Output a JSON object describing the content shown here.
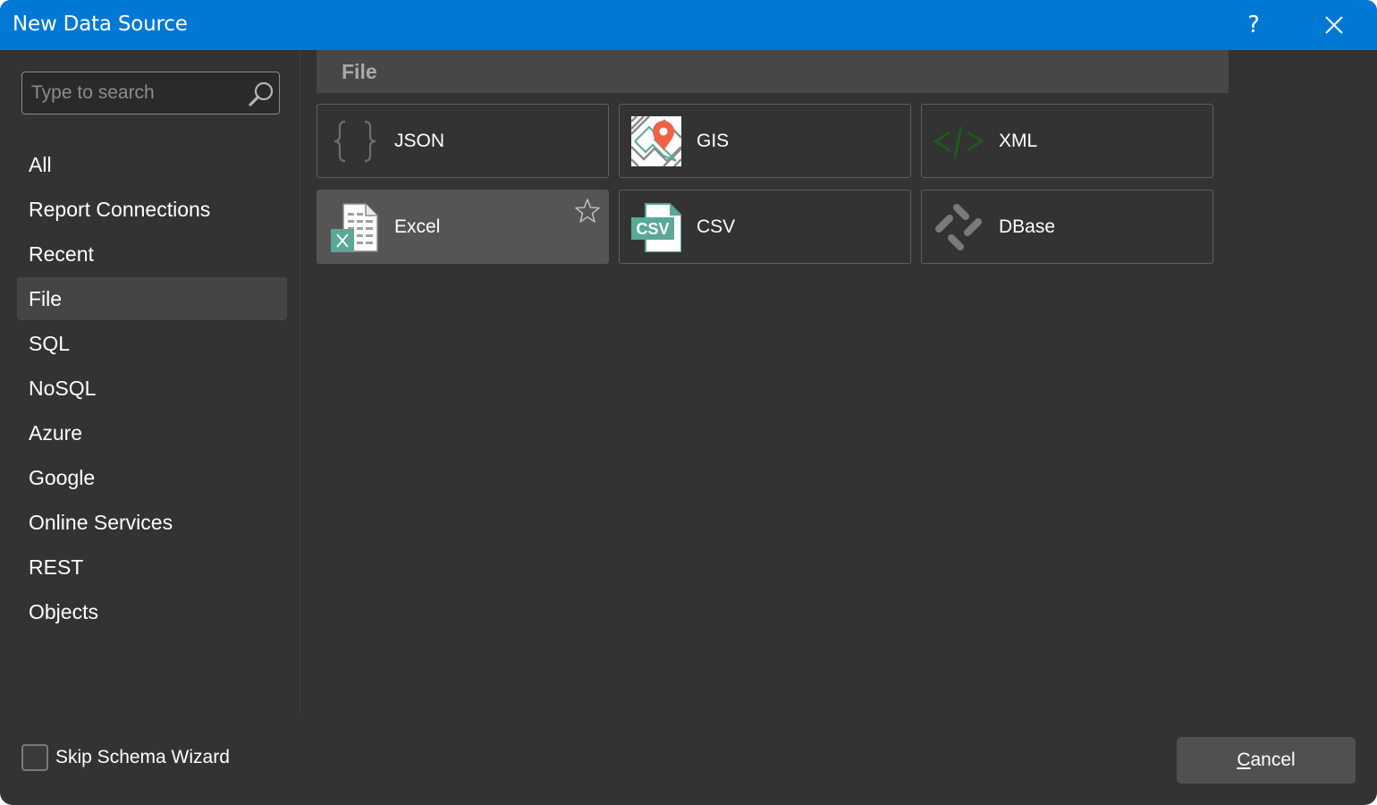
{
  "window": {
    "title": "New Data Source",
    "help_label": "?",
    "accent_color": "#0078d4"
  },
  "search": {
    "placeholder": "Type to search",
    "value": ""
  },
  "sidebar": {
    "items": [
      {
        "label": "All",
        "active": false
      },
      {
        "label": "Report Connections",
        "active": false
      },
      {
        "label": "Recent",
        "active": false
      },
      {
        "label": "File",
        "active": true
      },
      {
        "label": "SQL",
        "active": false
      },
      {
        "label": "NoSQL",
        "active": false
      },
      {
        "label": "Azure",
        "active": false
      },
      {
        "label": "Google",
        "active": false
      },
      {
        "label": "Online Services",
        "active": false
      },
      {
        "label": "REST",
        "active": false
      },
      {
        "label": "Objects",
        "active": false
      }
    ]
  },
  "group": {
    "title": "File",
    "sources": [
      {
        "label": "JSON",
        "icon": "json-braces-icon",
        "selected": false
      },
      {
        "label": "GIS",
        "icon": "gis-map-pin-icon",
        "selected": false
      },
      {
        "label": "XML",
        "icon": "xml-code-icon",
        "selected": false
      },
      {
        "label": "Excel",
        "icon": "excel-file-icon",
        "selected": true,
        "favorite_icon": "star-outline-icon"
      },
      {
        "label": "CSV",
        "icon": "csv-file-icon",
        "selected": false
      },
      {
        "label": "DBase",
        "icon": "dbase-icon",
        "selected": false
      }
    ]
  },
  "footer": {
    "skip_schema_label": "Skip Schema Wizard",
    "skip_schema_checked": false,
    "cancel_accel": "C",
    "cancel_rest": "ancel"
  }
}
